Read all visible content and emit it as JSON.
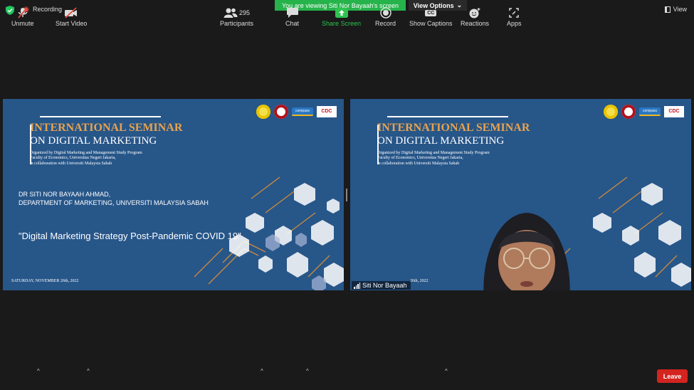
{
  "top": {
    "recording_label": "Recording",
    "viewing_banner": "You are viewing Siti Nor Bayaah's screen",
    "view_options_label": "View Options",
    "view_label": "View"
  },
  "slide": {
    "title_line1": "INTERNATIONAL SEMINAR",
    "title_line2": "ON DIGITAL MARKETING",
    "org_line1": "Organized by Digital Marketing and Management Study Program",
    "org_line2": "Faculty of Economics, Universitas Negeri Jakarta,",
    "org_line3": "in collaboration with Universiti Malaysia Sabah",
    "speaker_name": "DR SITI NOR BAYAAH AHMAD,",
    "speaker_dept": "DEPARTMENT OF MARKETING, UNIVERSITI MALAYSIA SABAH",
    "talk_title": "\"Digital Marketing Strategy Post-Pandemic COVID 19\"",
    "date": "SATURDAY, NOVEMBER 26th, 2022",
    "logo_cdc": "CDC",
    "logo_compass": "compass"
  },
  "video": {
    "participant_name": "Siti Nor Bayaah",
    "date_partial": "26th, 2022"
  },
  "toolbar": {
    "unmute": "Unmute",
    "start_video": "Start Video",
    "participants": "Participants",
    "participants_count": "295",
    "chat": "Chat",
    "share_screen": "Share Screen",
    "record": "Record",
    "show_captions": "Show Captions",
    "captions_badge": "CC",
    "reactions": "Reactions",
    "apps": "Apps",
    "leave": "Leave"
  },
  "colors": {
    "slide_bg": "#275689",
    "title_orange": "#e8a34e",
    "share_green": "#26b34b",
    "leave_red": "#d3241f"
  }
}
